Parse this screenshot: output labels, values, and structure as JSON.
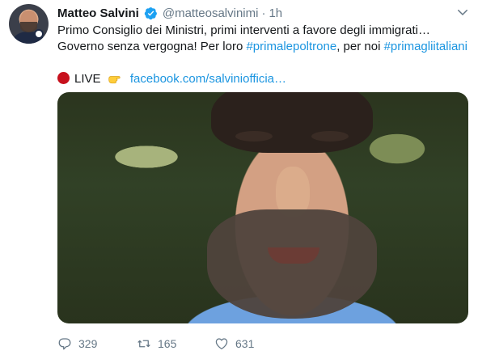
{
  "tweet": {
    "author_name": "Matteo Salvini",
    "handle": "@matteosalvinimi",
    "separator": "·",
    "time": "1h",
    "lines": [
      "Primo Consiglio dei Ministri, primi interventi a favore degli immigrati…"
    ],
    "line2_prefix": "Governo senza vergogna! Per loro ",
    "hashtag1": "#primalepoltrone",
    "line2_middle": ", per noi ",
    "hashtag2": "#primagliitaliani",
    "live_label": "LIVE",
    "link_text": "facebook.com/salviniofficia…",
    "counts": {
      "replies": "329",
      "retweets": "165",
      "likes": "631"
    }
  },
  "colors": {
    "text": "#14171a",
    "secondary": "#657786",
    "link": "#1b95e0",
    "verified": "#1da1f2",
    "live": "#c7111d"
  },
  "icons": {
    "verified": "verified-badge-icon",
    "menu": "chevron-down-icon",
    "live": "red-circle-icon",
    "pointer": "pointing-hand-icon",
    "reply": "reply-icon",
    "retweet": "retweet-icon",
    "like": "heart-icon"
  }
}
